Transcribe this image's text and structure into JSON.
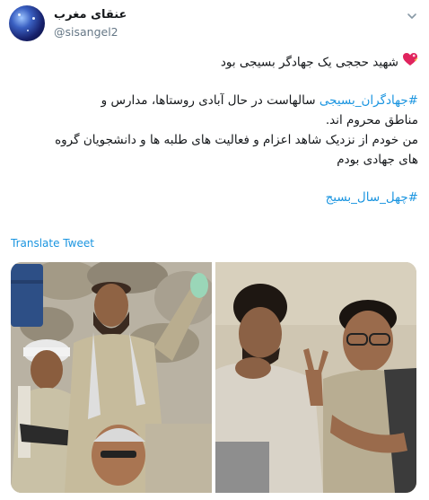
{
  "tweet": {
    "author": {
      "display_name": "عنقای مغرب",
      "handle": "@sisangel2"
    },
    "lines": [
      {
        "parts": [
          {
            "text": "شهید حججی یک جهادگر بسیجی بود",
            "hashtag": false
          }
        ],
        "emoji": "heart-icon"
      },
      {
        "parts": [
          {
            "text": "#جهادگران_بسیجی",
            "hashtag": true
          },
          {
            "text": " سالهاست در حال آبادی روستاها، مدارس و",
            "hashtag": false
          }
        ]
      },
      {
        "parts": [
          {
            "text": "مناطق محروم اند.",
            "hashtag": false
          }
        ]
      },
      {
        "parts": [
          {
            "text": " من خودم از نزدیک شاهد اعزام و فعالیت های طلبه ها و دانشجویان گروه",
            "hashtag": false
          }
        ]
      },
      {
        "parts": [
          {
            "text": "های جهادی بودم",
            "hashtag": false
          }
        ]
      },
      {
        "parts": [
          {
            "text": "#چهل_سال_بسیج",
            "hashtag": true
          }
        ]
      }
    ],
    "translate_label": "Translate Tweet"
  },
  "media": {
    "left_photo_alt": "three young men in keffiyeh scarves posing near rocks",
    "right_photo_alt": "young men smiling, one showing a V sign"
  },
  "colors": {
    "link": "#1b95e0",
    "text": "#14171a",
    "muted": "#657786"
  }
}
